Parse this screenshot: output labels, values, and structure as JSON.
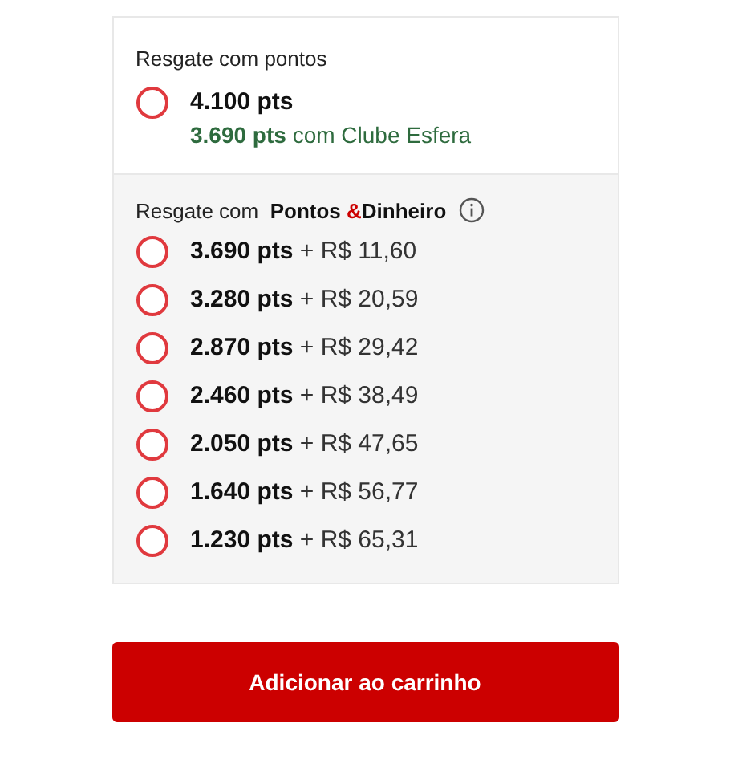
{
  "points_section": {
    "title": "Resgate com pontos",
    "option": {
      "selected": false,
      "points": "4.100 pts",
      "club_points": "3.690 pts",
      "club_label": "com Clube Esfera"
    }
  },
  "mixed_section": {
    "title": "Resgate com",
    "brand_first": "Pontos",
    "brand_amp": "&",
    "brand_second": "Dinheiro",
    "options": [
      {
        "selected": false,
        "points": "3.690 pts",
        "cash": "+ R$ 11,60"
      },
      {
        "selected": false,
        "points": "3.280 pts",
        "cash": "+ R$ 20,59"
      },
      {
        "selected": false,
        "points": "2.870 pts",
        "cash": "+ R$ 29,42"
      },
      {
        "selected": false,
        "points": "2.460 pts",
        "cash": "+ R$ 38,49"
      },
      {
        "selected": false,
        "points": "2.050 pts",
        "cash": "+ R$ 47,65"
      },
      {
        "selected": false,
        "points": "1.640 pts",
        "cash": "+ R$ 56,77"
      },
      {
        "selected": false,
        "points": "1.230 pts",
        "cash": "+ R$ 65,31"
      }
    ]
  },
  "add_button": "Adicionar ao carrinho"
}
